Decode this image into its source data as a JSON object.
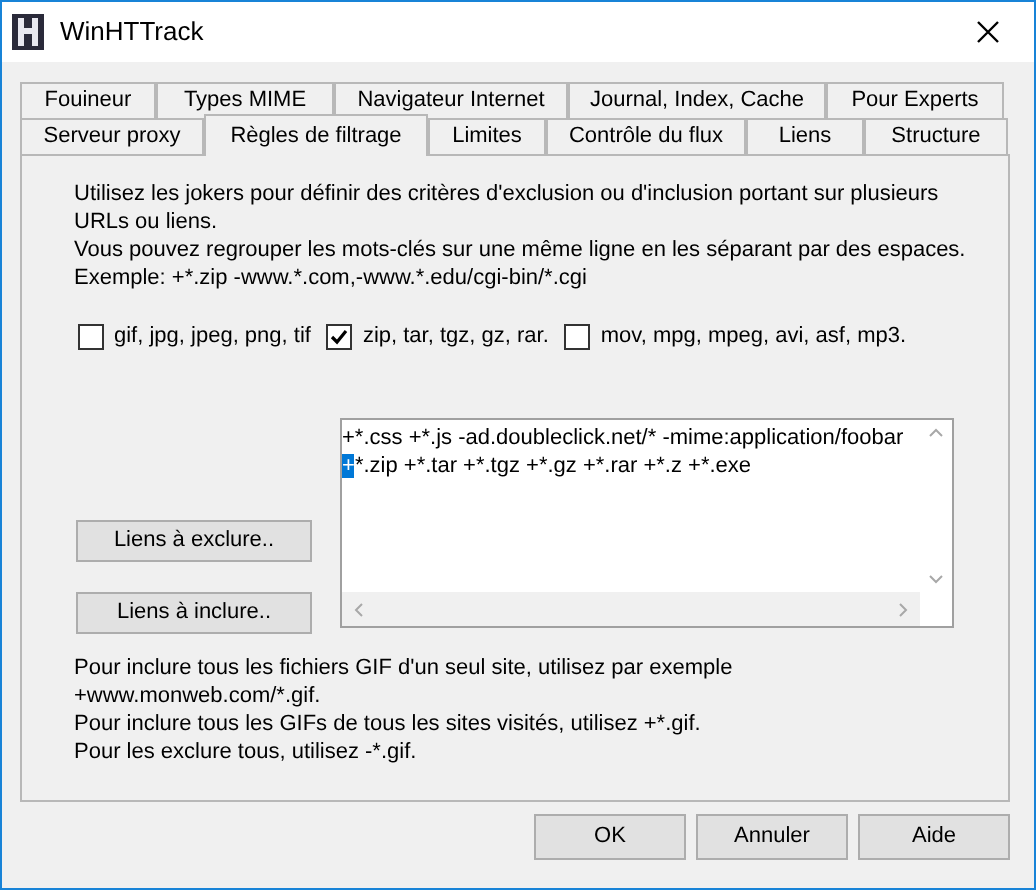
{
  "window": {
    "title": "WinHTTrack"
  },
  "tab_rows": [
    [
      {
        "label": "Fouineur",
        "selected": false
      },
      {
        "label": "Types MIME",
        "selected": false
      },
      {
        "label": "Navigateur Internet",
        "selected": false
      },
      {
        "label": "Journal, Index, Cache",
        "selected": false
      },
      {
        "label": "Pour Experts",
        "selected": false
      }
    ],
    [
      {
        "label": "Serveur proxy",
        "selected": false
      },
      {
        "label": "Règles de filtrage",
        "selected": true
      },
      {
        "label": "Limites",
        "selected": false
      },
      {
        "label": "Contrôle du flux",
        "selected": false
      },
      {
        "label": "Liens",
        "selected": false
      },
      {
        "label": "Structure",
        "selected": false
      }
    ]
  ],
  "intro": [
    "Utilisez les jokers pour définir des critères d'exclusion ou d'inclusion portant sur plusieurs URLs ou liens.",
    "Vous pouvez regrouper les mots-clés sur une même ligne en les séparant par des espaces.",
    "Exemple: +*.zip -www.*.com,-www.*.edu/cgi-bin/*.cgi"
  ],
  "checkboxes": [
    {
      "label": "gif, jpg, jpeg, png, tif",
      "checked": false
    },
    {
      "label": "zip, tar, tgz, gz, rar.",
      "checked": true
    },
    {
      "label": "mov, mpg, mpeg, avi, asf, mp3.",
      "checked": false
    }
  ],
  "side_buttons": [
    "Liens à exclure..",
    "Liens à inclure.."
  ],
  "filter_text": [
    [
      {
        "text": "+*.css +*.js -ad.doubleclick.net/* -mime:application/foobar",
        "selected": false
      }
    ],
    [
      {
        "text": "+",
        "selected": true
      },
      {
        "text": "*.zip +*.tar +*.tgz +*.gz +*.rar +*.z +*.exe",
        "selected": false
      }
    ]
  ],
  "help": [
    "Pour inclure tous les fichiers GIF d'un seul site, utilisez par exemple +www.monweb.com/*.gif.",
    "Pour inclure tous les GIFs de tous les sites visités, utilisez +*.gif.",
    "Pour les exclure tous, utilisez -*.gif."
  ],
  "buttons": [
    "OK",
    "Annuler",
    "Aide"
  ]
}
